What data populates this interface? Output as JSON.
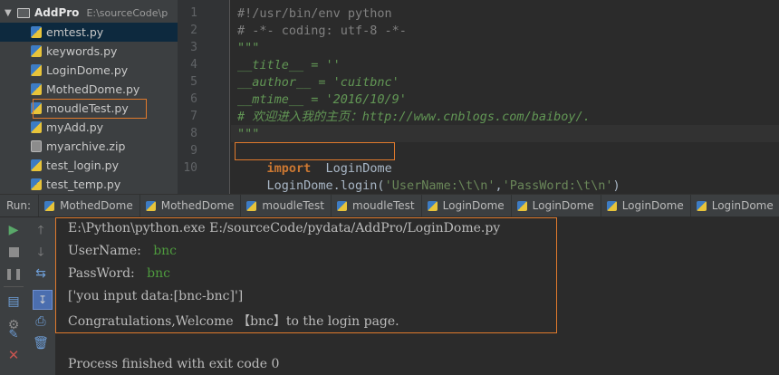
{
  "project": {
    "root_name": "AddPro",
    "root_path": "E:\\sourceCode\\p",
    "files": [
      {
        "name": "emtest.py",
        "type": "py"
      },
      {
        "name": "keywords.py",
        "type": "py"
      },
      {
        "name": "LoginDome.py",
        "type": "py"
      },
      {
        "name": "MothedDome.py",
        "type": "py"
      },
      {
        "name": "moudleTest.py",
        "type": "py"
      },
      {
        "name": "myAdd.py",
        "type": "py"
      },
      {
        "name": "myarchive.zip",
        "type": "zip"
      },
      {
        "name": "test_login.py",
        "type": "py"
      },
      {
        "name": "test_temp.py",
        "type": "py"
      }
    ]
  },
  "editor": {
    "line_numbers": [
      "1",
      "2",
      "3",
      "4",
      "5",
      "6",
      "7",
      "8",
      "9",
      "10"
    ],
    "lines": {
      "l1": "#!/usr/bin/env python",
      "l2": "# -*- coding: utf-8 -*-",
      "l3": "\"\"\"",
      "l4": "__title__ = ''",
      "l5": "__author__ = 'cuitbnc'",
      "l6": "__mtime__ = '2016/10/9'",
      "l7": "# 欢迎进入我的主页：http://www.cnblogs.com/baiboy/.",
      "l8": "\"\"\"",
      "l9_kw": "import",
      "l9_rest": "  LoginDome",
      "l10_call": "LoginDome.login(",
      "l10_arg1": "'UserName:\\t\\n'",
      "l10_comma": ",",
      "l10_arg2": "'PassWord:\\t\\n'",
      "l10_close": ")"
    }
  },
  "run": {
    "label": "Run:",
    "tabs": [
      "MothedDome",
      "MothedDome",
      "moudleTest",
      "moudleTest",
      "LoginDome",
      "LoginDome",
      "LoginDome",
      "LoginDome"
    ]
  },
  "console": {
    "command": "E:\\Python\\python.exe E:/sourceCode/pydata/AddPro/LoginDome.py",
    "username_prompt": "UserName:",
    "username_input": "bnc",
    "password_prompt": "PassWord:",
    "password_input": "bnc",
    "data_line": "['you input data:[bnc-bnc]']",
    "congrats": "Congratulations,Welcome 【bnc】to the login page.",
    "exit": "Process finished with exit code 0"
  },
  "colors": {
    "highlight_border": "#e07a2c",
    "keyword": "#cc7832",
    "string": "#6a8759",
    "docstring": "#629755",
    "input_green": "#4e9a3e"
  },
  "icons": [
    "folder-icon",
    "python-file-icon",
    "zip-file-icon",
    "run-icon",
    "stop-icon",
    "pause-icon",
    "up-arrow-icon",
    "down-arrow-icon",
    "soft-wrap-icon",
    "scroll-to-end-icon",
    "print-icon",
    "pin-icon",
    "close-icon",
    "trash-icon",
    "settings-icon"
  ]
}
